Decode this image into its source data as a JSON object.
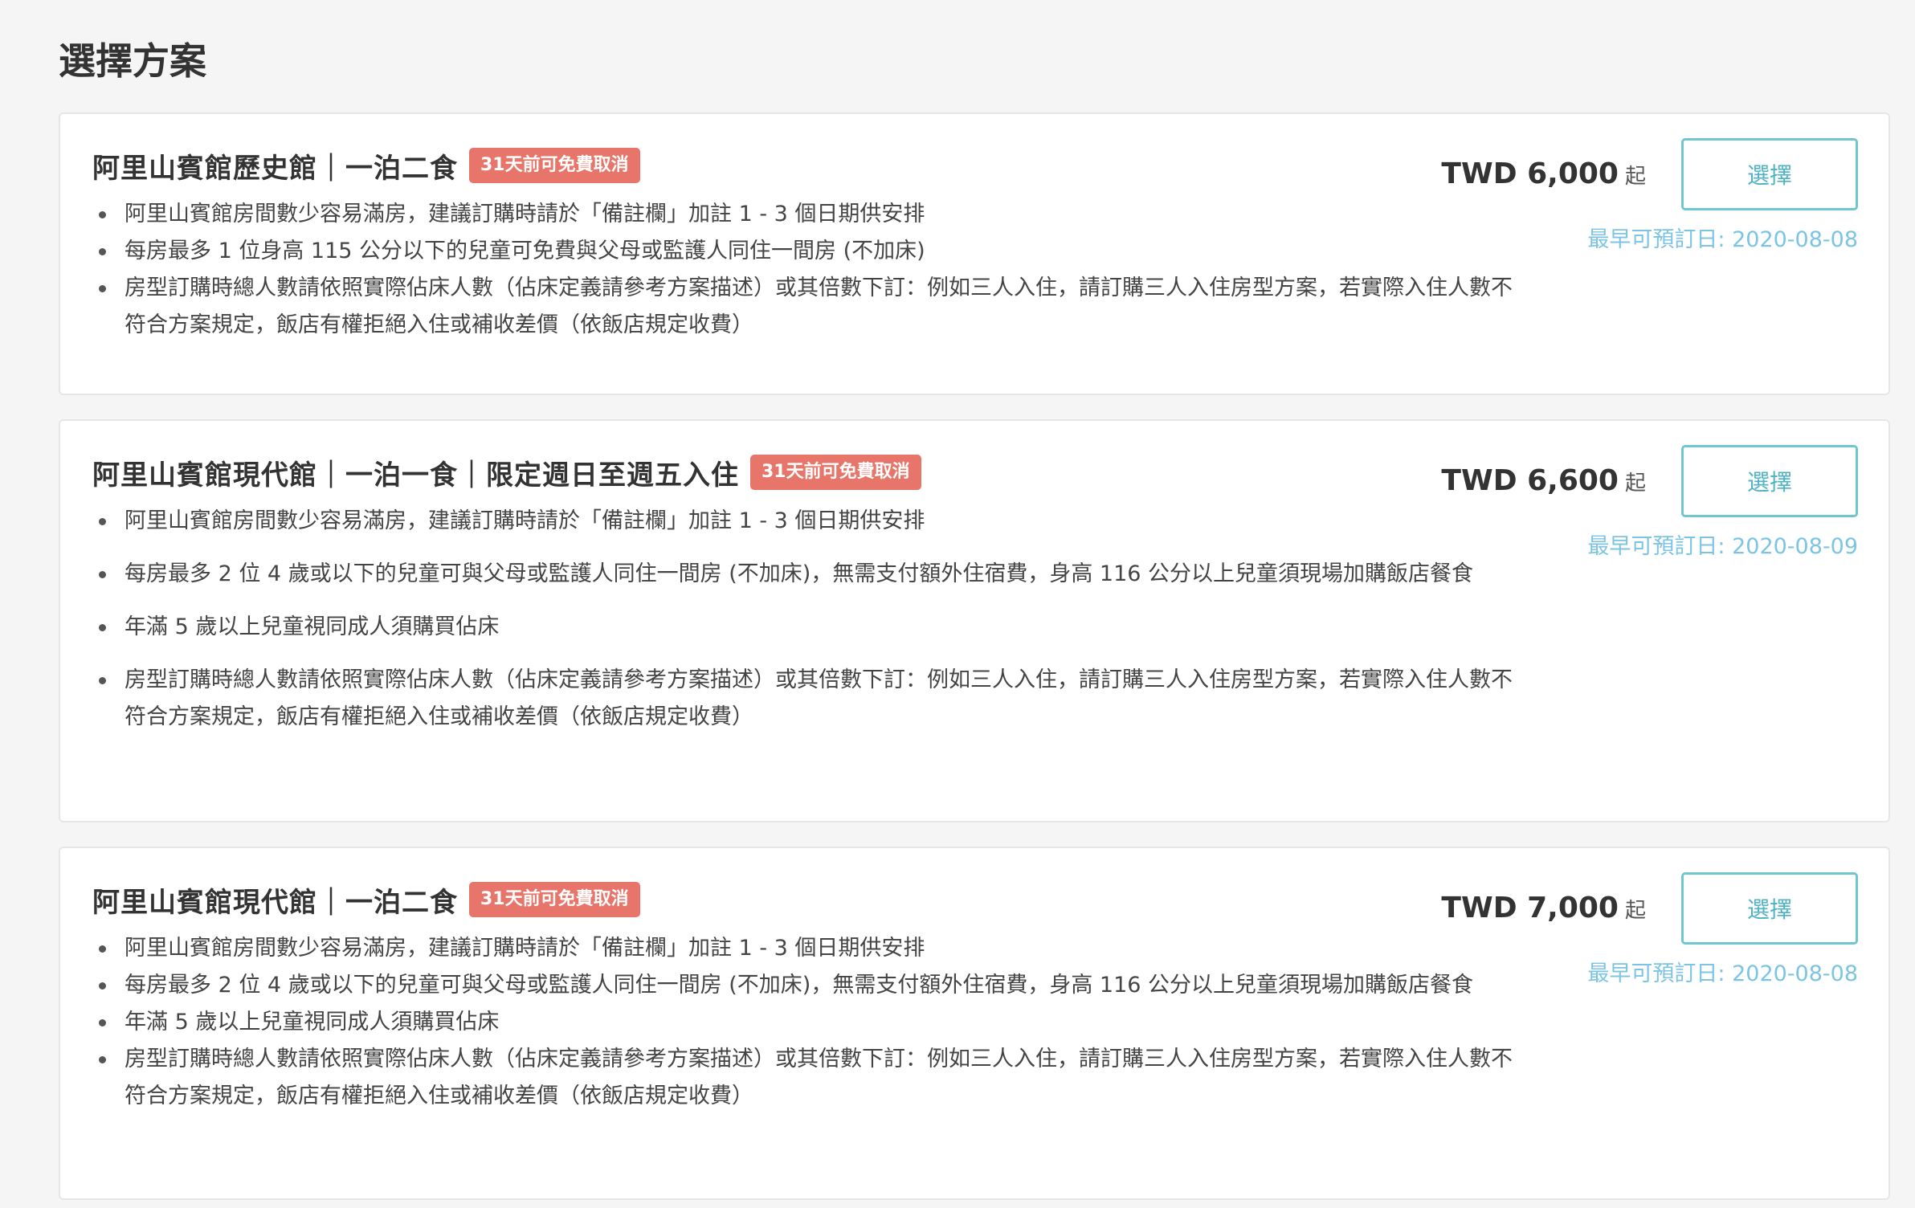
{
  "section_title": "選擇方案",
  "plans": [
    {
      "title": "阿里山賓館歷史館｜一泊二食",
      "badge": "31天前可免費取消",
      "bullets": [
        "阿里山賓館房間數少容易滿房，建議訂購時請於「備註欄」加註 1 - 3 個日期供安排",
        "每房最多 1 位身高 115 公分以下的兒童可免費與父母或監護人同住一間房 (不加床)",
        "房型訂購時總人數請依照實際佔床人數（佔床定義請參考方案描述）或其倍數下訂：例如三人入住，請訂購三人入住房型方案，若實際入住人數不符合方案規定，飯店有權拒絕入住或補收差價（依飯店規定收費）"
      ],
      "price": "TWD 6,000",
      "price_suffix": "起",
      "button_label": "選擇",
      "earliest_date": "最早可預訂日: 2020-08-08"
    },
    {
      "title": "阿里山賓館現代館｜一泊一食｜限定週日至週五入住",
      "badge": "31天前可免費取消",
      "bullets": [
        "阿里山賓館房間數少容易滿房，建議訂購時請於「備註欄」加註 1 - 3 個日期供安排",
        "每房最多 2 位 4 歲或以下的兒童可與父母或監護人同住一間房 (不加床)，無需支付額外住宿費，身高 116 公分以上兒童須現場加購飯店餐食",
        "年滿 5 歲以上兒童視同成人須購買佔床",
        "房型訂購時總人數請依照實際佔床人數（佔床定義請參考方案描述）或其倍數下訂：例如三人入住，請訂購三人入住房型方案，若實際入住人數不符合方案規定，飯店有權拒絕入住或補收差價（依飯店規定收費）"
      ],
      "price": "TWD 6,600",
      "price_suffix": "起",
      "button_label": "選擇",
      "earliest_date": "最早可預訂日: 2020-08-09"
    },
    {
      "title": "阿里山賓館現代館｜一泊二食",
      "badge": "31天前可免費取消",
      "bullets": [
        "阿里山賓館房間數少容易滿房，建議訂購時請於「備註欄」加註 1 - 3 個日期供安排",
        "每房最多 2 位 4 歲或以下的兒童可與父母或監護人同住一間房 (不加床)，無需支付額外住宿費，身高 116 公分以上兒童須現場加購飯店餐食",
        "年滿 5 歲以上兒童視同成人須購買佔床",
        "房型訂購時總人數請依照實際佔床人數（佔床定義請參考方案描述）或其倍數下訂：例如三人入住，請訂購三人入住房型方案，若實際入住人數不符合方案規定，飯店有權拒絕入住或補收差價（依飯店規定收費）"
      ],
      "price": "TWD 7,000",
      "price_suffix": "起",
      "button_label": "選擇",
      "earliest_date": "最早可預訂日: 2020-08-08"
    }
  ]
}
